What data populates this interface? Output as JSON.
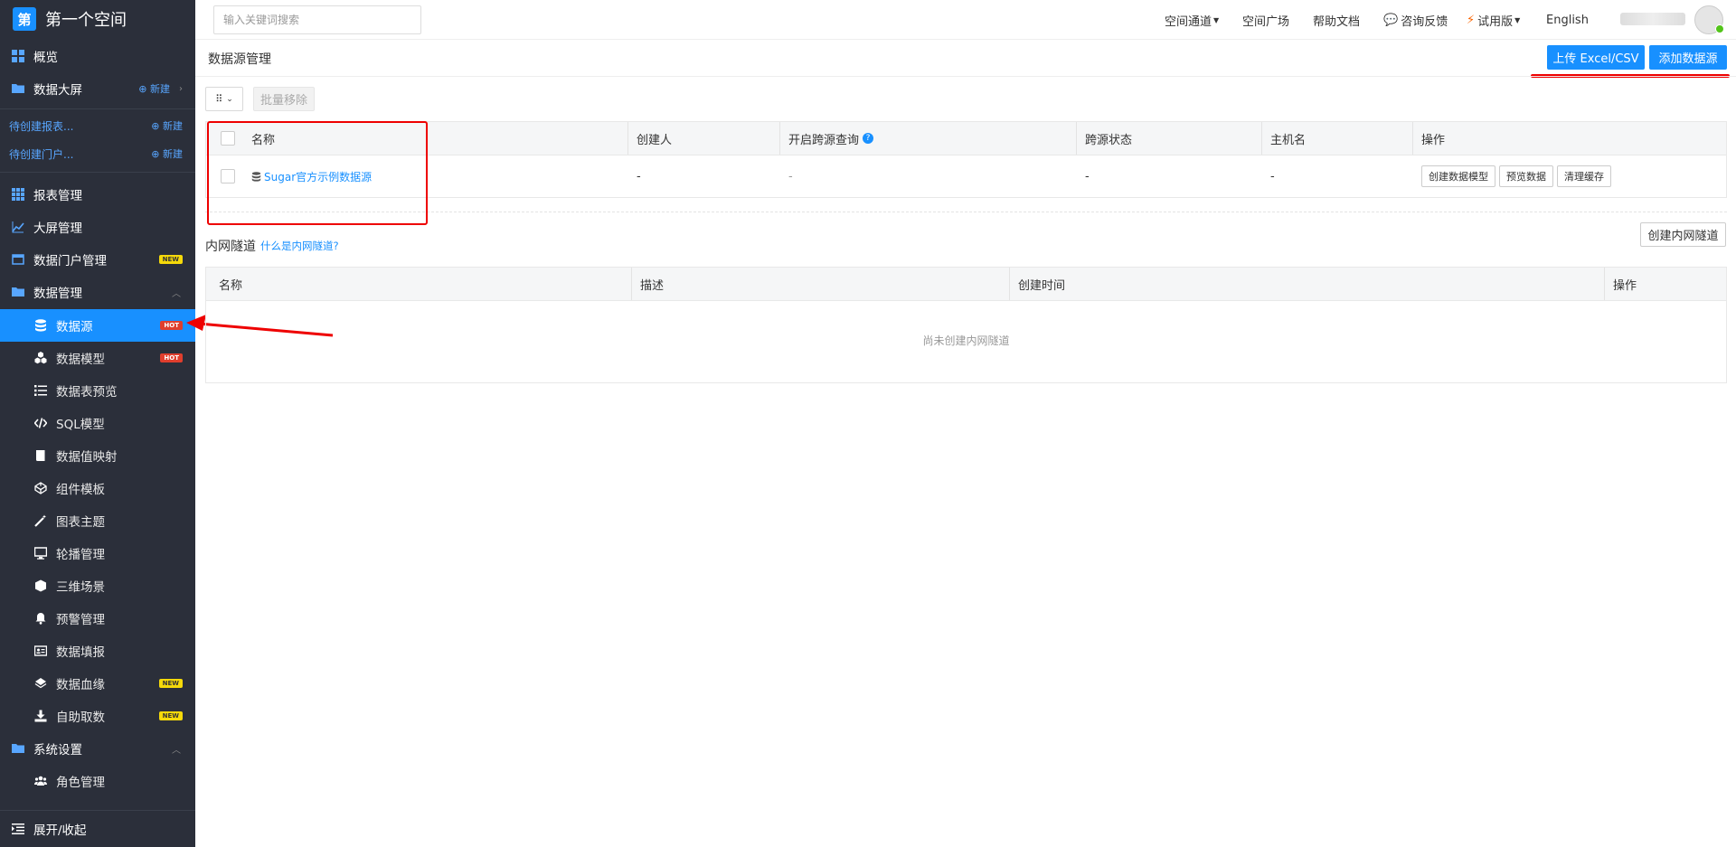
{
  "sidebar": {
    "brand_logo": "第",
    "brand_title": "第一个空间",
    "overview": "概览",
    "big_screen": "数据大屏",
    "new": "新建",
    "draft_report": "待创建报表...",
    "draft_portal": "待创建门户...",
    "items": [
      {
        "label": "报表管理"
      },
      {
        "label": "大屏管理"
      },
      {
        "label": "数据门户管理",
        "badge": "NEW"
      },
      {
        "label": "数据管理"
      },
      {
        "label": "数据源",
        "badge": "HOT"
      },
      {
        "label": "数据模型",
        "badge": "HOT"
      },
      {
        "label": "数据表预览"
      },
      {
        "label": "SQL模型"
      },
      {
        "label": "数据值映射"
      },
      {
        "label": "组件模板"
      },
      {
        "label": "图表主题"
      },
      {
        "label": "轮播管理"
      },
      {
        "label": "三维场景"
      },
      {
        "label": "预警管理"
      },
      {
        "label": "数据填报"
      },
      {
        "label": "数据血缘",
        "badge": "NEW"
      },
      {
        "label": "自助取数",
        "badge": "NEW"
      },
      {
        "label": "系统设置"
      },
      {
        "label": "角色管理"
      }
    ],
    "footer": "展开/收起"
  },
  "topbar": {
    "search_placeholder": "输入关键词搜索",
    "nav": [
      "空间通道",
      "空间广场",
      "帮助文档",
      "咨询反馈",
      "试用版",
      "English"
    ]
  },
  "main": {
    "page_title": "数据源管理",
    "upload_button": "上传 Excel/CSV",
    "add_button": "添加数据源",
    "batch_remove": "批量移除",
    "datasource_table": {
      "headers": [
        "名称",
        "创建人",
        "开启跨源查询",
        "跨源状态",
        "主机名",
        "操作"
      ],
      "row": {
        "name": "Sugar官方示例数据源",
        "creator": "-",
        "cross_query": "-",
        "cross_status": "-",
        "host": "-",
        "actions": [
          "创建数据模型",
          "预览数据",
          "清理缓存"
        ]
      }
    },
    "tunnel": {
      "title": "内网隧道",
      "link": "什么是内网隧道?",
      "create_button": "创建内网隧道",
      "headers": [
        "名称",
        "描述",
        "创建时间",
        "操作"
      ],
      "empty": "尚未创建内网隧道"
    }
  },
  "colors": {
    "sidebar_bg": "#2b2f3a",
    "primary": "#1890ff",
    "annotation_red": "#e00000"
  }
}
